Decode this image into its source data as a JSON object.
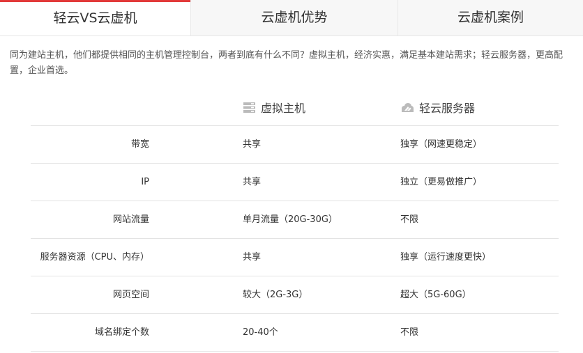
{
  "tabs": [
    {
      "label": "轻云VS云虚机",
      "active": true
    },
    {
      "label": "云虚机优势",
      "active": false
    },
    {
      "label": "云虚机案例",
      "active": false
    }
  ],
  "intro": "同为建站主机，他们都提供相同的主机管理控制台，两者到底有什么不同？虚拟主机，经济实惠，满足基本建站需求；轻云服务器，更高配置，企业首选。",
  "table": {
    "columns": [
      {
        "label": "",
        "icon": ""
      },
      {
        "label": "虚拟主机",
        "icon": "server-icon"
      },
      {
        "label": "轻云服务器",
        "icon": "cloud-icon"
      }
    ],
    "rows": [
      [
        "带宽",
        "共享",
        "独享（网速更稳定）"
      ],
      [
        "IP",
        "共享",
        "独立（更易做推广）"
      ],
      [
        "网站流量",
        "单月流量（20G-30G）",
        "不限"
      ],
      [
        "服务器资源（CPU、内存）",
        "共享",
        "独享（运行速度更快）"
      ],
      [
        "网页空间",
        "较大（2G-3G）",
        "超大（5G-60G）"
      ],
      [
        "域名绑定个数",
        "20-40个",
        "不限"
      ]
    ]
  },
  "colors": {
    "accent": "#e23a3a",
    "icon_gray": "#bbbbbb"
  }
}
